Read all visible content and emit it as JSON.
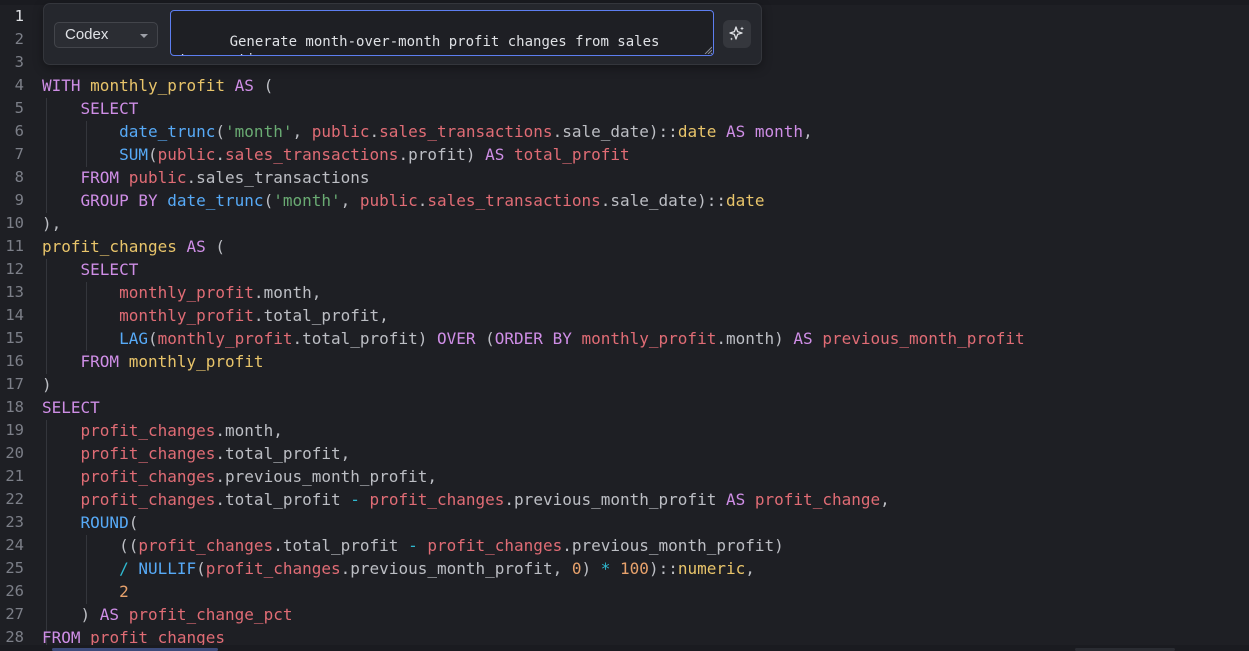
{
  "ai_prompt": {
    "model_selected": "Codex",
    "prompt_text": "Generate month-over-month profit changes from sales transaction",
    "generate_icon": "sparkle-icon"
  },
  "gutter": {
    "active_line": 1,
    "line_numbers": [
      "1",
      "2",
      "3",
      "4",
      "5",
      "6",
      "7",
      "8",
      "9",
      "10",
      "11",
      "12",
      "13",
      "14",
      "15",
      "16",
      "17",
      "18",
      "19",
      "20",
      "21",
      "22",
      "23",
      "24",
      "25",
      "26",
      "27",
      "28"
    ]
  },
  "code_lines": [
    [],
    [],
    [],
    [
      [
        "kw",
        "WITH"
      ],
      [
        "pun",
        " "
      ],
      [
        "cte",
        "monthly_profit"
      ],
      [
        "pun",
        " "
      ],
      [
        "kw",
        "AS"
      ],
      [
        "pun",
        " ("
      ]
    ],
    [
      [
        "pun",
        "    "
      ],
      [
        "kw",
        "SELECT"
      ]
    ],
    [
      [
        "pun",
        "        "
      ],
      [
        "fn",
        "date_trunc"
      ],
      [
        "pun",
        "("
      ],
      [
        "str",
        "'month'"
      ],
      [
        "pun",
        ", "
      ],
      [
        "tbl",
        "public"
      ],
      [
        "pun",
        "."
      ],
      [
        "tbl",
        "sales_transactions"
      ],
      [
        "pun",
        "."
      ],
      [
        "col",
        "sale_date"
      ],
      [
        "pun",
        ")::"
      ],
      [
        "type",
        "date"
      ],
      [
        "pun",
        " "
      ],
      [
        "kw",
        "AS"
      ],
      [
        "pun",
        " "
      ],
      [
        "kw",
        "month"
      ],
      [
        "pun",
        ","
      ]
    ],
    [
      [
        "pun",
        "        "
      ],
      [
        "fn",
        "SUM"
      ],
      [
        "pun",
        "("
      ],
      [
        "tbl",
        "public"
      ],
      [
        "pun",
        "."
      ],
      [
        "tbl",
        "sales_transactions"
      ],
      [
        "pun",
        "."
      ],
      [
        "col",
        "profit"
      ],
      [
        "pun",
        ") "
      ],
      [
        "kw",
        "AS"
      ],
      [
        "pun",
        " "
      ],
      [
        "tbl",
        "total_profit"
      ]
    ],
    [
      [
        "pun",
        "    "
      ],
      [
        "kw",
        "FROM"
      ],
      [
        "pun",
        " "
      ],
      [
        "tbl",
        "public"
      ],
      [
        "pun",
        "."
      ],
      [
        "col",
        "sales_transactions"
      ]
    ],
    [
      [
        "pun",
        "    "
      ],
      [
        "kw",
        "GROUP BY"
      ],
      [
        "pun",
        " "
      ],
      [
        "fn",
        "date_trunc"
      ],
      [
        "pun",
        "("
      ],
      [
        "str",
        "'month'"
      ],
      [
        "pun",
        ", "
      ],
      [
        "tbl",
        "public"
      ],
      [
        "pun",
        "."
      ],
      [
        "tbl",
        "sales_transactions"
      ],
      [
        "pun",
        "."
      ],
      [
        "col",
        "sale_date"
      ],
      [
        "pun",
        ")::"
      ],
      [
        "type",
        "date"
      ]
    ],
    [
      [
        "pun",
        "),"
      ]
    ],
    [
      [
        "cte",
        "profit_changes"
      ],
      [
        "pun",
        " "
      ],
      [
        "kw",
        "AS"
      ],
      [
        "pun",
        " ("
      ]
    ],
    [
      [
        "pun",
        "    "
      ],
      [
        "kw",
        "SELECT"
      ]
    ],
    [
      [
        "pun",
        "        "
      ],
      [
        "tbl",
        "monthly_profit"
      ],
      [
        "pun",
        "."
      ],
      [
        "col",
        "month"
      ],
      [
        "pun",
        ","
      ]
    ],
    [
      [
        "pun",
        "        "
      ],
      [
        "tbl",
        "monthly_profit"
      ],
      [
        "pun",
        "."
      ],
      [
        "col",
        "total_profit"
      ],
      [
        "pun",
        ","
      ]
    ],
    [
      [
        "pun",
        "        "
      ],
      [
        "fn",
        "LAG"
      ],
      [
        "pun",
        "("
      ],
      [
        "tbl",
        "monthly_profit"
      ],
      [
        "pun",
        "."
      ],
      [
        "col",
        "total_profit"
      ],
      [
        "pun",
        ") "
      ],
      [
        "kw",
        "OVER"
      ],
      [
        "pun",
        " ("
      ],
      [
        "kw",
        "ORDER BY"
      ],
      [
        "pun",
        " "
      ],
      [
        "tbl",
        "monthly_profit"
      ],
      [
        "pun",
        "."
      ],
      [
        "col",
        "month"
      ],
      [
        "pun",
        ") "
      ],
      [
        "kw",
        "AS"
      ],
      [
        "pun",
        " "
      ],
      [
        "tbl",
        "previous_month_profit"
      ]
    ],
    [
      [
        "pun",
        "    "
      ],
      [
        "kw",
        "FROM"
      ],
      [
        "pun",
        " "
      ],
      [
        "cte",
        "monthly_profit"
      ]
    ],
    [
      [
        "pun",
        ")"
      ]
    ],
    [
      [
        "kw",
        "SELECT"
      ]
    ],
    [
      [
        "pun",
        "    "
      ],
      [
        "tbl",
        "profit_changes"
      ],
      [
        "pun",
        "."
      ],
      [
        "col",
        "month"
      ],
      [
        "pun",
        ","
      ]
    ],
    [
      [
        "pun",
        "    "
      ],
      [
        "tbl",
        "profit_changes"
      ],
      [
        "pun",
        "."
      ],
      [
        "col",
        "total_profit"
      ],
      [
        "pun",
        ","
      ]
    ],
    [
      [
        "pun",
        "    "
      ],
      [
        "tbl",
        "profit_changes"
      ],
      [
        "pun",
        "."
      ],
      [
        "col",
        "previous_month_profit"
      ],
      [
        "pun",
        ","
      ]
    ],
    [
      [
        "pun",
        "    "
      ],
      [
        "tbl",
        "profit_changes"
      ],
      [
        "pun",
        "."
      ],
      [
        "col",
        "total_profit"
      ],
      [
        "pun",
        " "
      ],
      [
        "op",
        "-"
      ],
      [
        "pun",
        " "
      ],
      [
        "tbl",
        "profit_changes"
      ],
      [
        "pun",
        "."
      ],
      [
        "col",
        "previous_month_profit"
      ],
      [
        "pun",
        " "
      ],
      [
        "kw",
        "AS"
      ],
      [
        "pun",
        " "
      ],
      [
        "tbl",
        "profit_change"
      ],
      [
        "pun",
        ","
      ]
    ],
    [
      [
        "pun",
        "    "
      ],
      [
        "fn",
        "ROUND"
      ],
      [
        "pun",
        "("
      ]
    ],
    [
      [
        "pun",
        "        (("
      ],
      [
        "tbl",
        "profit_changes"
      ],
      [
        "pun",
        "."
      ],
      [
        "col",
        "total_profit"
      ],
      [
        "pun",
        " "
      ],
      [
        "op",
        "-"
      ],
      [
        "pun",
        " "
      ],
      [
        "tbl",
        "profit_changes"
      ],
      [
        "pun",
        "."
      ],
      [
        "col",
        "previous_month_profit"
      ],
      [
        "pun",
        ")"
      ]
    ],
    [
      [
        "pun",
        "        "
      ],
      [
        "op",
        "/"
      ],
      [
        "pun",
        " "
      ],
      [
        "fn",
        "NULLIF"
      ],
      [
        "pun",
        "("
      ],
      [
        "tbl",
        "profit_changes"
      ],
      [
        "pun",
        "."
      ],
      [
        "col",
        "previous_month_profit"
      ],
      [
        "pun",
        ", "
      ],
      [
        "num",
        "0"
      ],
      [
        "pun",
        ") "
      ],
      [
        "op",
        "*"
      ],
      [
        "pun",
        " "
      ],
      [
        "num",
        "100"
      ],
      [
        "pun",
        ")::"
      ],
      [
        "type",
        "numeric"
      ],
      [
        "pun",
        ","
      ]
    ],
    [
      [
        "pun",
        "        "
      ],
      [
        "num",
        "2"
      ]
    ],
    [
      [
        "pun",
        "    ) "
      ],
      [
        "kw",
        "AS"
      ],
      [
        "pun",
        " "
      ],
      [
        "tbl",
        "profit_change_pct"
      ]
    ],
    [
      [
        "kw",
        "FROM"
      ],
      [
        "pun",
        " "
      ],
      [
        "tbl",
        "profit_changes"
      ]
    ]
  ],
  "colors": {
    "keyword": "#cf8ee6",
    "function": "#57aaf7",
    "string": "#6aab73",
    "cte_name": "#e8c46a",
    "table_ref": "#e06c75",
    "operator": "#2fbad1",
    "number": "#e8a26c",
    "text": "#bcbec4",
    "accent_border": "#5d7ef0"
  }
}
